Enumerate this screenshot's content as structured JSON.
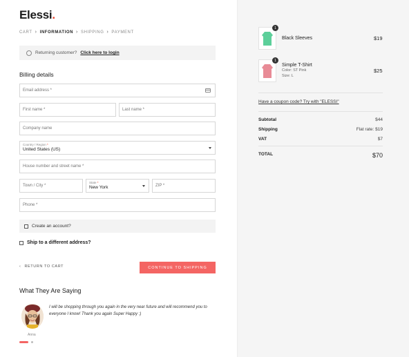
{
  "brand": {
    "name": "Elessi",
    "dot": "."
  },
  "breadcrumb": [
    "CART",
    "INFORMATION",
    "SHIPPING",
    "PAYMENT"
  ],
  "returning": {
    "text": "Returning customer?",
    "link": "Click here to login"
  },
  "billing": {
    "title": "Billing details",
    "email_placeholder": "Email address *",
    "first_name_placeholder": "First name *",
    "last_name_placeholder": "Last name *",
    "company_placeholder": "Company name",
    "country_label": "Country / Region",
    "country_value": "United States (US)",
    "address_placeholder": "House number and street name *",
    "city_placeholder": "Town / City *",
    "state_label": "State",
    "state_value": "New York",
    "zip_placeholder": "ZIP *",
    "phone_placeholder": "Phone *",
    "create_account": "Create an account?",
    "ship_different": "Ship to a different address?"
  },
  "actions": {
    "return_cart": "RETURN TO CART",
    "continue": "CONTINUE TO SHIPPING"
  },
  "testimonials": {
    "title": "What They Are Saying",
    "quote": "I will be shopping through you again in the very near future and will recommend you to everyone I know! Thank you again Super Happy :)",
    "name": "Anna"
  },
  "order": {
    "items": [
      {
        "qty": "1",
        "name": "Black Sleeves",
        "price": "$19",
        "color": "#5ccf9a"
      },
      {
        "qty": "1",
        "name": "Simple T-Shirt",
        "color_line": "Color: ST Pink",
        "size_line": "Size: L",
        "price": "$25",
        "color": "#e88b96"
      }
    ],
    "coupon": "Have a coupon code? Try with \"ELESSI\"",
    "subtotal_label": "Subtotal",
    "subtotal": "$44",
    "shipping_label": "Shipping",
    "shipping": "Flat rate: $19",
    "vat_label": "VAT",
    "vat": "$7",
    "total_label": "TOTAL",
    "total": "$70"
  },
  "colors": {
    "accent": "#f46563",
    "brand_dot": "#e8402a",
    "panel_bg": "#f5f5f5"
  }
}
